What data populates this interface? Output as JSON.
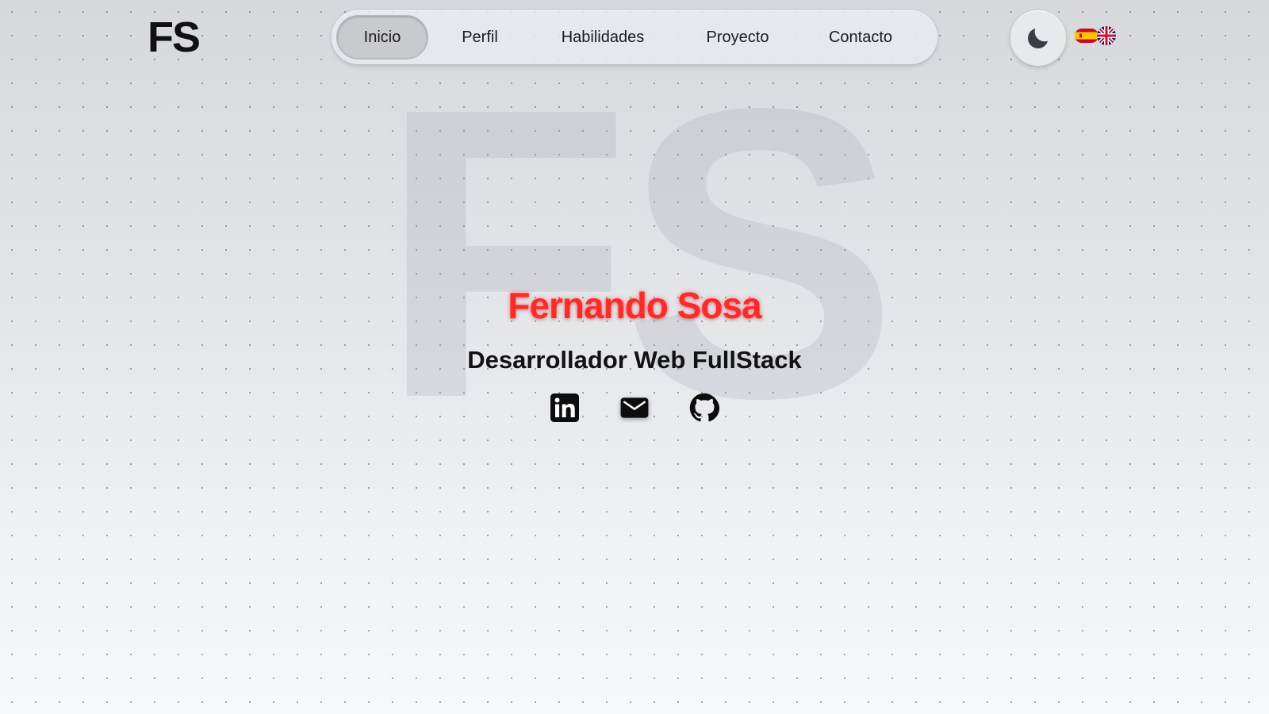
{
  "background": {
    "monogram": "FS"
  },
  "header": {
    "logo": "FS",
    "nav": [
      {
        "label": "Inicio",
        "active": true
      },
      {
        "label": "Perfil",
        "active": false
      },
      {
        "label": "Habilidades",
        "active": false
      },
      {
        "label": "Proyecto",
        "active": false
      },
      {
        "label": "Contacto",
        "active": false
      }
    ],
    "theme_toggle_icon": "moon-icon",
    "language_switch_icons": [
      "spain-flag-icon",
      "uk-flag-icon"
    ]
  },
  "hero": {
    "name": "Fernando Sosa",
    "role": "Desarrollador Web FullStack",
    "name_color": "#ff2a2a",
    "socials": [
      {
        "icon": "linkedin-icon"
      },
      {
        "icon": "mail-icon"
      },
      {
        "icon": "github-icon"
      }
    ]
  }
}
